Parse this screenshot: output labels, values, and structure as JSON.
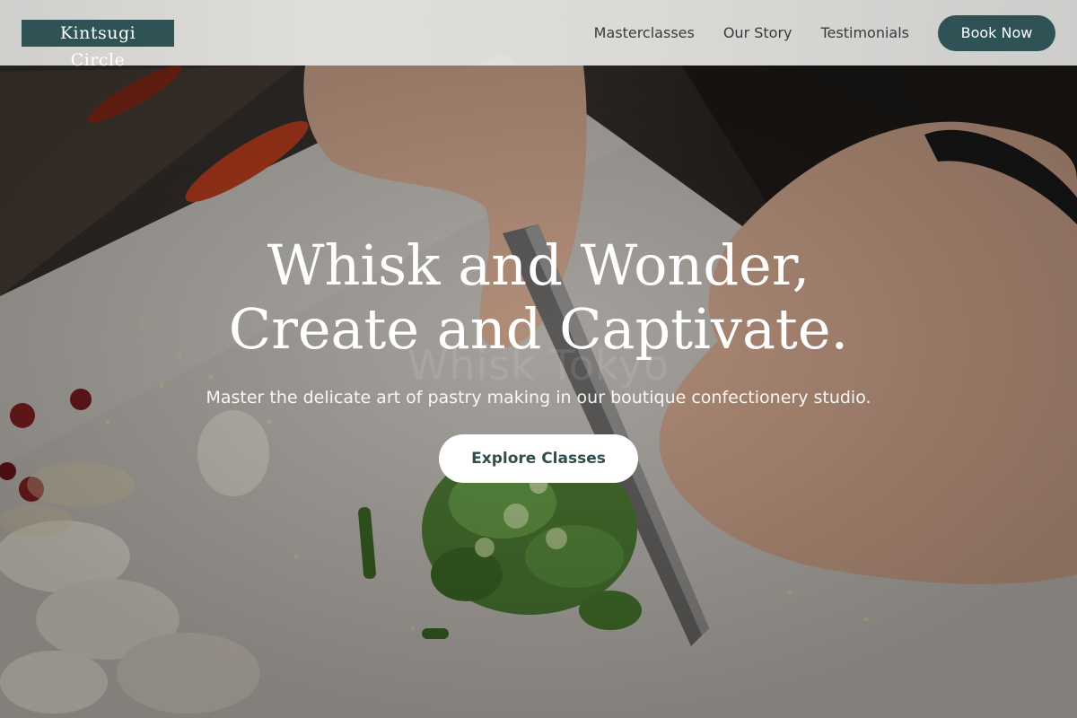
{
  "header": {
    "logo": "Kintsugi Circle",
    "nav": [
      "Masterclasses",
      "Our Story",
      "Testimonials"
    ],
    "cta": "Book Now"
  },
  "hero": {
    "title_line1": "Whisk and Wonder,",
    "title_line2": "Create and Captivate.",
    "watermark": "Whisk Tokyo",
    "subtitle": "Master the delicate art of pastry making in our boutique confectionery studio.",
    "cta": "Explore Classes"
  },
  "colors": {
    "brand": "#2f5355",
    "header_bg": "#e2e1de",
    "cta_text": "#2f4f4f"
  }
}
